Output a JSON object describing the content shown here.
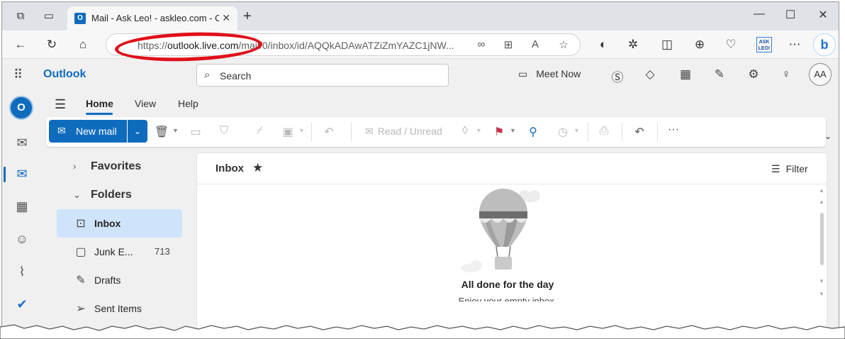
{
  "browser": {
    "tab_title": "Mail - Ask Leo! - askleo.com - Outlook",
    "tab_favicon": "outlook-favicon",
    "url_host": "outlook.live.com",
    "url_prefix": "https://",
    "url_path": "/mail/0/inbox/id/AQQkADAwATZiZmYAZC1jNW...",
    "askleo_badge": "ASK LEO!",
    "bing_label": "b",
    "highlight_color": "#e0101a"
  },
  "outlook": {
    "brand": "Outlook",
    "search_placeholder": "Search",
    "meet_now": "Meet Now",
    "avatar_initials": "AA",
    "rail_logo": "O",
    "ribbon_tabs": [
      "Home",
      "View",
      "Help"
    ],
    "active_tab": "Home",
    "new_mail": "New mail",
    "read_unread": "Read / Unread",
    "more": "···",
    "accent": "#0f6cbd"
  },
  "folders": {
    "favorites": "Favorites",
    "folders": "Folders",
    "items": [
      {
        "name": "Inbox",
        "count": "",
        "icon": "inbox-icon"
      },
      {
        "name": "Junk E...",
        "count": "713",
        "icon": "junk-folder-icon"
      },
      {
        "name": "Drafts",
        "count": "",
        "icon": "drafts-icon"
      },
      {
        "name": "Sent Items",
        "count": "",
        "icon": "sent-icon"
      }
    ]
  },
  "list": {
    "title": "Inbox",
    "filter": "Filter",
    "empty_title": "All done for the day",
    "empty_subtitle": "Enjoy your empty inbox."
  }
}
